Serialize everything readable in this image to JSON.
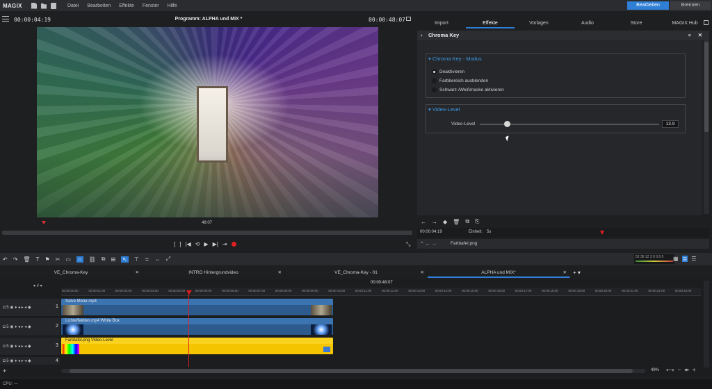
{
  "menubar": {
    "logo": "MAGIX",
    "items": [
      "Datei",
      "Bearbeiten",
      "Effekte",
      "Fenster",
      "Hilfe"
    ],
    "mode_edit": "Bearbeiten",
    "mode_burn": "Brennen"
  },
  "preview": {
    "timecode_left": "00:00:04:19",
    "title": "Programm: ALPHA und MIX *",
    "timecode_right": "00:00:48:07",
    "scrub_time": "48:07"
  },
  "right_panel": {
    "tabs": [
      "Import",
      "Effekte",
      "Vorlagen",
      "Audio",
      "Store",
      "MAGIX Hub"
    ],
    "active_tab": "Effekte",
    "header": "Chroma Key",
    "group1_title": "Chroma Key - Modus",
    "options": [
      "Deaktivieren",
      "Farbbereich ausblenden",
      "Schwarz-/Weißmaske aktivieren"
    ],
    "selected_option": "Deaktivieren",
    "group2_title": "Video-Level",
    "slider_label": "Video-Level",
    "slider_value": "13.9",
    "slider_fraction": 0.15,
    "ruler_time": "00:00:04:19",
    "unit_label": "Einheit:",
    "unit_value": "5s",
    "file_name": "Farbtafel.png"
  },
  "project_tabs": [
    {
      "label": "VE_Chroma-Key",
      "active": false
    },
    {
      "label": "INTRO Hintergrundvideo",
      "active": false
    },
    {
      "label": "VE_Chroma-Key - 01",
      "active": false
    },
    {
      "label": "ALPHA und MIX*",
      "active": true
    }
  ],
  "timeline": {
    "time": "00:00:48:07",
    "ruler_labels": [
      "00:00:00:00",
      "00:00:01:00",
      "00:00:02:00",
      "00:00:03:00",
      "00:00:04:00",
      "00:00:05:00",
      "00:00:06:00",
      "00:00:07:00",
      "00:00:08:00",
      "00:00:09:00",
      "00:00:10:00",
      "00:00:11:00",
      "00:00:12:00",
      "00:00:13:00",
      "00:00:14:00",
      "00:00:15:00",
      "00:00:16:00",
      "00:00:17:00",
      "00:00:18:00",
      "00:00:19:00",
      "00:00:20:00",
      "00:00:21:00",
      "00:00:22:00",
      "00:00:23:00"
    ],
    "tracks": [
      {
        "num": "1",
        "clip": "Salve Meter.mp4"
      },
      {
        "num": "2",
        "clip": "LichteffektIen.mp4  White Box"
      },
      {
        "num": "3",
        "clip": "Farbtafel.png   Video-Level"
      },
      {
        "num": "4",
        "clip": ""
      }
    ],
    "zoom": "49%",
    "vu_labels": "52  36  12   3  0  3  6  5"
  },
  "statusbar": {
    "cpu": "CPU: —"
  }
}
